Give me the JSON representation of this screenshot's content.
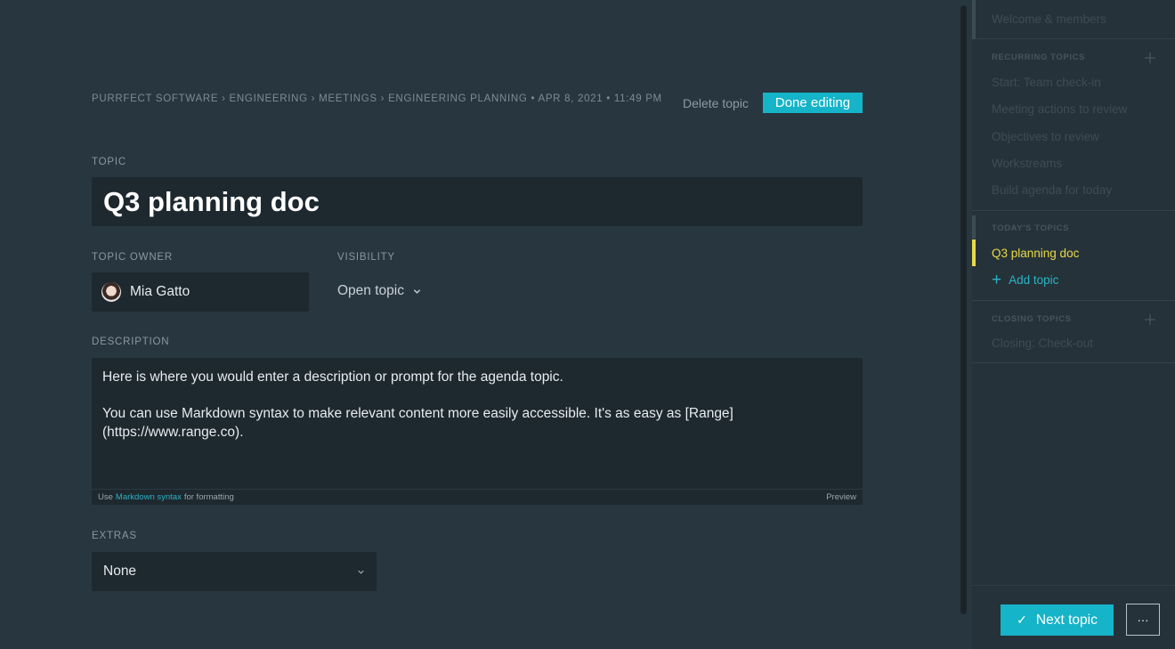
{
  "breadcrumb": "PURRFECT SOFTWARE › ENGINEERING › MEETINGS › ENGINEERING PLANNING • APR 8, 2021 • 11:49 PM",
  "header": {
    "delete_label": "Delete topic",
    "done_label": "Done editing"
  },
  "form": {
    "topic_label": "TOPIC",
    "topic_value": "Q3 planning doc",
    "owner_label": "TOPIC OWNER",
    "owner_name": "Mia Gatto",
    "visibility_label": "VISIBILITY",
    "visibility_value": "Open topic",
    "description_label": "DESCRIPTION",
    "description_text": "Here is where you would enter a description or prompt for the agenda topic.\n\nYou can use Markdown syntax to make relevant content more easily accessible. It's as easy as [Range]\n(https://www.range.co).",
    "footer_use": "Use",
    "footer_link": "Markdown syntax",
    "footer_rest": "for formatting",
    "footer_preview": "Preview",
    "extras_label": "EXTRAS",
    "extras_value": "None"
  },
  "sidebar": {
    "welcome": "Welcome & members",
    "recurring_header": "RECURRING TOPICS",
    "recurring_items": [
      "Start: Team check-in",
      "Meeting actions to review",
      "Objectives to review",
      "Workstreams",
      "Build agenda for today"
    ],
    "today_header": "TODAY'S TOPICS",
    "today_items": [
      "Q3 planning doc"
    ],
    "add_topic": "Add topic",
    "closing_header": "CLOSING TOPICS",
    "closing_items": [
      "Closing: Check-out"
    ]
  },
  "footer": {
    "next_label": "Next topic",
    "more_label": "···"
  },
  "colors": {
    "accent": "#16b4c8",
    "active_topic": "#e8d94a",
    "background": "#283640"
  }
}
